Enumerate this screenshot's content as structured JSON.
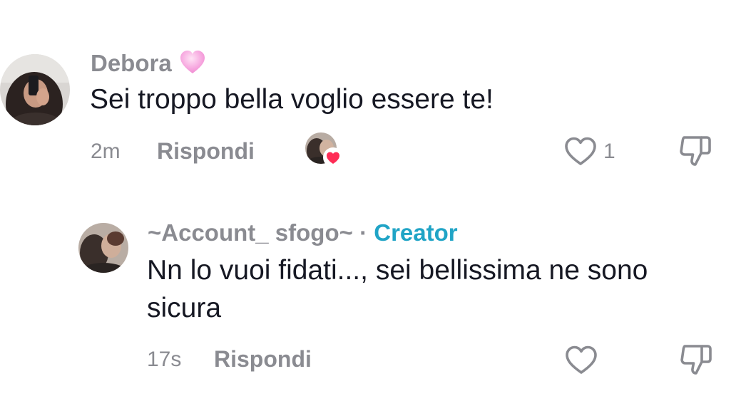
{
  "comments": [
    {
      "username": "Debora",
      "username_emoji": "pink-heart",
      "text": "Sei troppo bella voglio essere te!",
      "time": "2m",
      "reply_label": "Rispondi",
      "likes": "1",
      "creator_liked": true
    }
  ],
  "replies": [
    {
      "username": "~Account_ sfogo~",
      "separator": "·",
      "badge": "Creator",
      "text": "Nn lo vuoi fidati..., sei bellissima ne sono sicura",
      "time": "17s",
      "reply_label": "Rispondi"
    }
  ],
  "colors": {
    "username": "#8a8b91",
    "text": "#161823",
    "creator_badge": "#20a4c6",
    "heart_badge": "#fe2c55"
  }
}
